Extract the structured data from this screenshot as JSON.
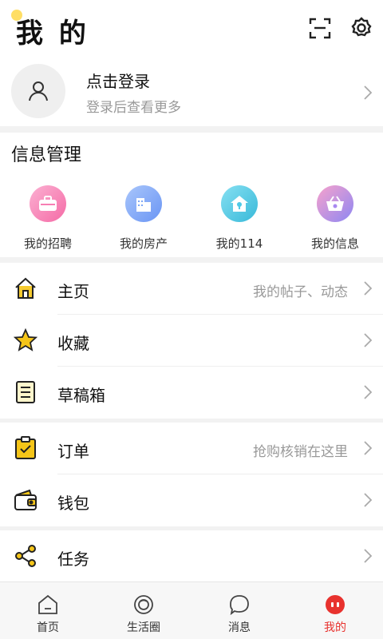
{
  "header": {
    "title": "我 的"
  },
  "login": {
    "title": "点击登录",
    "subtitle": "登录后查看更多"
  },
  "info": {
    "title": "信息管理",
    "items": [
      {
        "label": "我的招聘",
        "icon": "briefcase-icon",
        "color": "#f77fb4"
      },
      {
        "label": "我的房产",
        "icon": "building-icon",
        "color": "#7da7f7"
      },
      {
        "label": "我的114",
        "icon": "house-key-icon",
        "color": "#4fc9e6"
      },
      {
        "label": "我的信息",
        "icon": "basket-icon",
        "color": "#a889f0"
      }
    ]
  },
  "menu": [
    {
      "label": "主页",
      "hint": "我的帖子、动态",
      "icon": "home-icon"
    },
    {
      "label": "收藏",
      "hint": "",
      "icon": "star-icon"
    },
    {
      "label": "草稿箱",
      "hint": "",
      "icon": "draft-icon"
    },
    {
      "label": "订单",
      "hint": "抢购核销在这里",
      "icon": "order-icon"
    },
    {
      "label": "钱包",
      "hint": "",
      "icon": "wallet-icon"
    },
    {
      "label": "任务",
      "hint": "",
      "icon": "share-icon"
    }
  ],
  "tabs": [
    {
      "label": "首页",
      "icon": "home-tab-icon"
    },
    {
      "label": "生活圈",
      "icon": "circle-tab-icon"
    },
    {
      "label": "消息",
      "icon": "message-tab-icon"
    },
    {
      "label": "我的",
      "icon": "profile-tab-icon",
      "active": true
    }
  ],
  "colors": {
    "accent": "#e8322e",
    "highlight": "#f5c518"
  }
}
